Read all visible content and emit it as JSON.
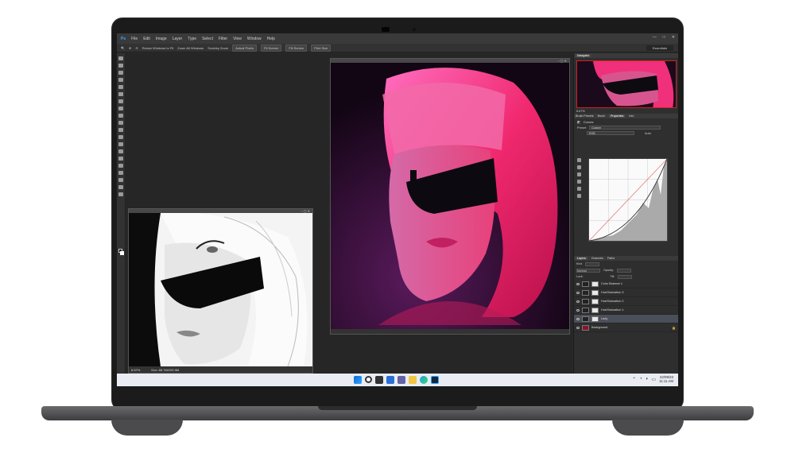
{
  "menu": [
    "File",
    "Edit",
    "Image",
    "Layer",
    "Type",
    "Select",
    "Filter",
    "View",
    "Window",
    "Help"
  ],
  "window_controls": [
    "—",
    "□",
    "✕"
  ],
  "options_bar": {
    "checks": [
      "Resize Windows to Fit",
      "Zoom All Windows",
      "Scrubby Zoom"
    ],
    "buttons": [
      "Actual Pixels",
      "Fit Screen",
      "Fill Screen",
      "Print Size"
    ],
    "workspace": "Essentials"
  },
  "bw_doc": {
    "zoom": "8.67%",
    "doc_size": "Doc: 68.7M/205.9M"
  },
  "panels": {
    "top_tabs": [
      "Navigator"
    ],
    "nav_zoom": "8.67%",
    "mid_tabs": [
      "Brush Presets",
      "Brush",
      "Properties",
      "Info"
    ],
    "props_title": "Curves",
    "preset_label": "Preset:",
    "preset_value": "Custom",
    "channel_value": "RGB",
    "auto_label": "Auto",
    "layer_tabs": [
      "Layers",
      "Channels",
      "Paths"
    ],
    "kind_label": "Kind",
    "blend_mode": "Normal",
    "opacity_label": "Opacity:",
    "lock_label": "Lock:",
    "fill_label": "Fill:",
    "layers": [
      {
        "name": "Color Balance 1",
        "thumb": "light"
      },
      {
        "name": "Hue/Saturation 3",
        "thumb": "light"
      },
      {
        "name": "Hue/Saturation 2",
        "thumb": "light"
      },
      {
        "name": "Hue/Saturation 1",
        "thumb": "light"
      },
      {
        "name": "Lady",
        "thumb": "dark",
        "selected": true
      },
      {
        "name": "Background",
        "thumb": "red"
      }
    ]
  },
  "taskbar": {
    "time": "11:11 AM",
    "date": "22/09/23",
    "tray_icons": [
      "chevron-up-icon",
      "wifi-icon",
      "volume-icon",
      "battery-icon"
    ]
  }
}
